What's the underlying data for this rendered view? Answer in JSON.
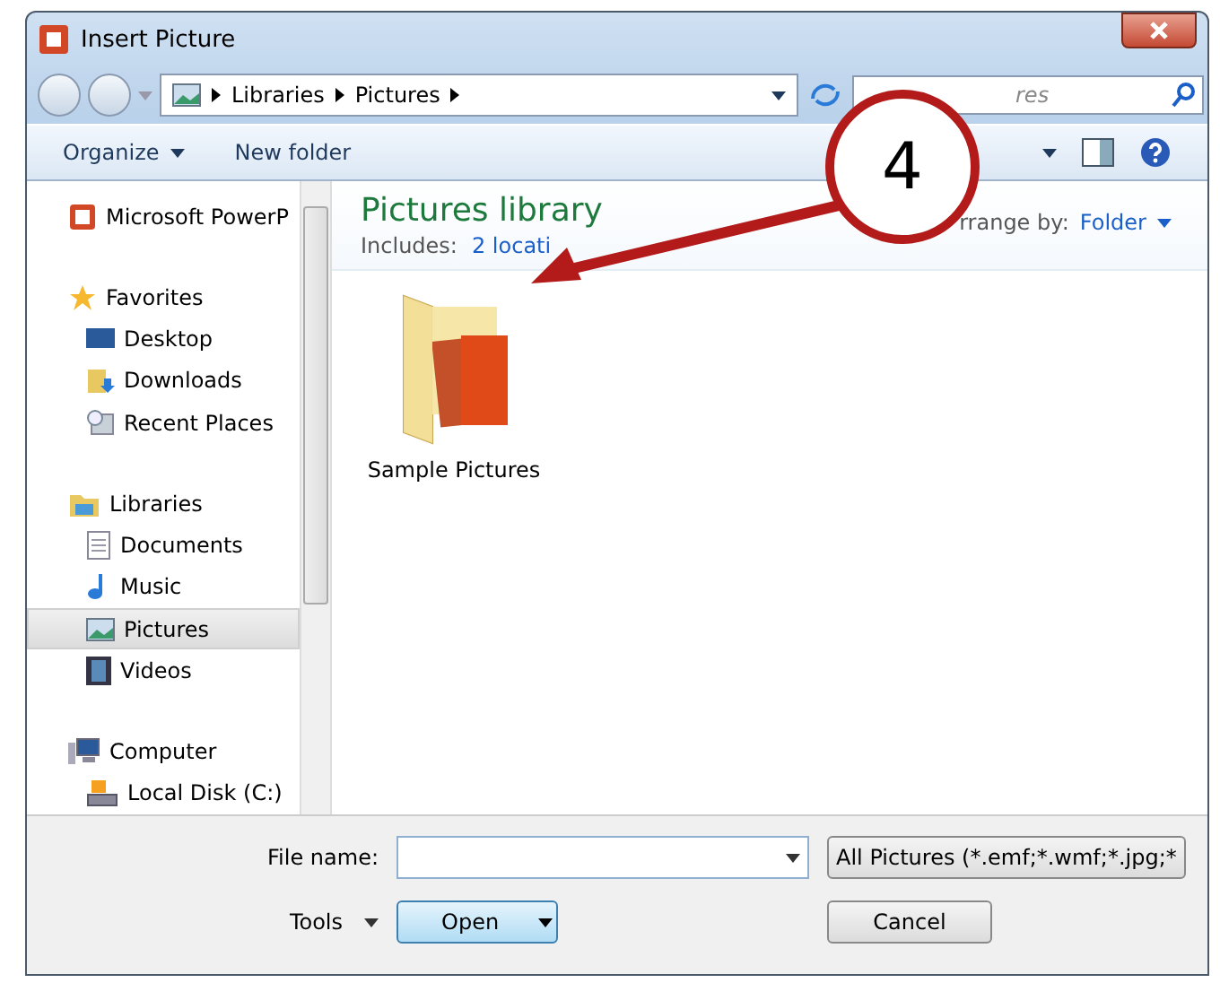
{
  "window": {
    "title": "Insert Picture"
  },
  "address": {
    "crumbs": [
      "Libraries",
      "Pictures"
    ]
  },
  "search": {
    "placeholder": "res"
  },
  "toolbar": {
    "buttons": [
      {
        "label": "Organize",
        "dropdown": true
      },
      {
        "label": "New folder",
        "dropdown": false
      }
    ]
  },
  "sidebar": {
    "sections": [
      {
        "label": "Microsoft PowerP",
        "kind": "app",
        "selected": false
      },
      {
        "label": "Favorites",
        "kind": "star",
        "selected": false,
        "children": [
          {
            "label": "Desktop",
            "kind": "desktop",
            "selected": false
          },
          {
            "label": "Downloads",
            "kind": "download",
            "selected": false
          },
          {
            "label": "Recent Places",
            "kind": "recent",
            "selected": false
          }
        ]
      },
      {
        "label": "Libraries",
        "kind": "library",
        "selected": false,
        "children": [
          {
            "label": "Documents",
            "kind": "document",
            "selected": false
          },
          {
            "label": "Music",
            "kind": "music",
            "selected": false
          },
          {
            "label": "Pictures",
            "kind": "picture",
            "selected": true
          },
          {
            "label": "Videos",
            "kind": "video",
            "selected": false
          }
        ]
      },
      {
        "label": "Computer",
        "kind": "computer",
        "selected": false,
        "children": [
          {
            "label": "Local Disk (C:)",
            "kind": "disk",
            "selected": false
          }
        ]
      }
    ]
  },
  "library": {
    "title": "Pictures library",
    "includes_label": "Includes:",
    "includes_link": "2 locati",
    "arrange_label": "rrange by:",
    "arrange_value": "Folder"
  },
  "items": [
    {
      "name": "Sample Pictures"
    }
  ],
  "footer": {
    "file_name_label": "File name:",
    "filter": "All Pictures (*.emf;*.wmf;*.jpg;*",
    "tools": "Tools",
    "open": "Open",
    "cancel": "Cancel"
  },
  "callout": {
    "number": "4"
  }
}
